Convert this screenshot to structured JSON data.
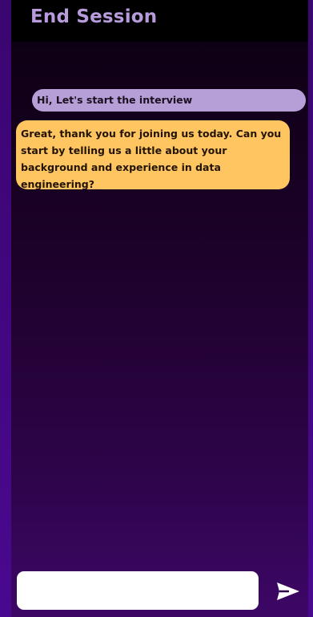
{
  "header": {
    "end_session_label": "End Session"
  },
  "chat": {
    "messages": [
      {
        "role": "user",
        "text": "Hi, Let's start the interview"
      },
      {
        "role": "assistant",
        "text": "Great, thank you for joining us today. Can you start by telling us a little about your background and experience in data engineering?"
      }
    ]
  },
  "composer": {
    "input_value": "",
    "input_placeholder": "",
    "send_icon": "send-icon"
  },
  "colors": {
    "header_text": "#b79bdd",
    "user_bubble": "#b69fd6",
    "assistant_bubble": "#fec560",
    "background_top": "#0b0010",
    "background_bottom": "#3d0766"
  }
}
